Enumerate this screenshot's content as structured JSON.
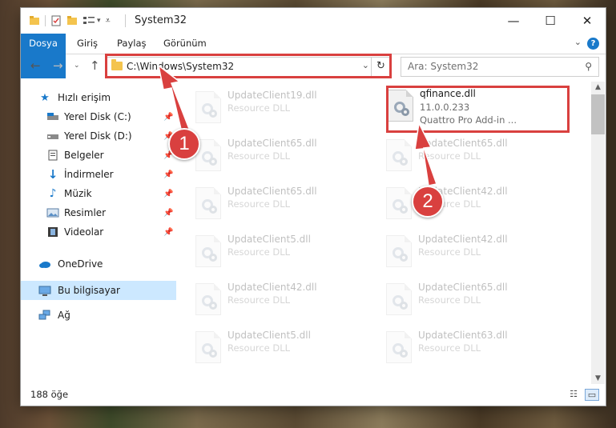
{
  "window": {
    "title": "System32",
    "minimize": "—",
    "maximize": "☐",
    "close": "✕"
  },
  "ribbon": {
    "tabs": [
      "Dosya",
      "Giriş",
      "Paylaş",
      "Görünüm"
    ],
    "help": "?"
  },
  "address": {
    "path": "C:\\Windows\\System32",
    "search_placeholder": "Ara: System32"
  },
  "nav": {
    "quick_access": "Hızlı erişim",
    "items": [
      {
        "label": "Yerel Disk (C:)",
        "icon": "drive-icon",
        "pinned": true
      },
      {
        "label": "Yerel Disk (D:)",
        "icon": "drive-icon",
        "pinned": true
      },
      {
        "label": "Belgeler",
        "icon": "documents-icon",
        "pinned": true
      },
      {
        "label": "İndirmeler",
        "icon": "download-icon",
        "pinned": true
      },
      {
        "label": "Müzik",
        "icon": "music-icon",
        "pinned": true
      },
      {
        "label": "Resimler",
        "icon": "pictures-icon",
        "pinned": true
      },
      {
        "label": "Videolar",
        "icon": "videos-icon",
        "pinned": true
      }
    ],
    "onedrive": "OneDrive",
    "this_pc": "Bu bilgisayar",
    "network": "Ağ"
  },
  "files": {
    "highlighted": {
      "name": "qfinance.dll",
      "version": "11.0.0.233",
      "description": "Quattro Pro Add-in ..."
    },
    "left_column": [
      {
        "name": "UpdateClient19.dll",
        "type": "Resource DLL"
      },
      {
        "name": "UpdateClient65.dll",
        "type": "Resource DLL"
      },
      {
        "name": "UpdateClient65.dll",
        "type": "Resource DLL"
      },
      {
        "name": "UpdateClient5.dll",
        "type": "Resource DLL"
      },
      {
        "name": "UpdateClient42.dll",
        "type": "Resource DLL"
      },
      {
        "name": "UpdateClient5.dll",
        "type": "Resource DLL"
      }
    ],
    "right_column": [
      {
        "name": "UpdateClient65.dll",
        "type": "Resource DLL"
      },
      {
        "name": "UpdateClient42.dll",
        "type": "Resource DLL"
      },
      {
        "name": "UpdateClient42.dll",
        "type": "Resource DLL"
      },
      {
        "name": "UpdateClient65.dll",
        "type": "Resource DLL"
      },
      {
        "name": "UpdateClient63.dll",
        "type": "Resource DLL"
      }
    ]
  },
  "status": {
    "count": "188 öğe"
  },
  "annotations": {
    "step1": "1",
    "step2": "2",
    "color": "#d9403f"
  }
}
